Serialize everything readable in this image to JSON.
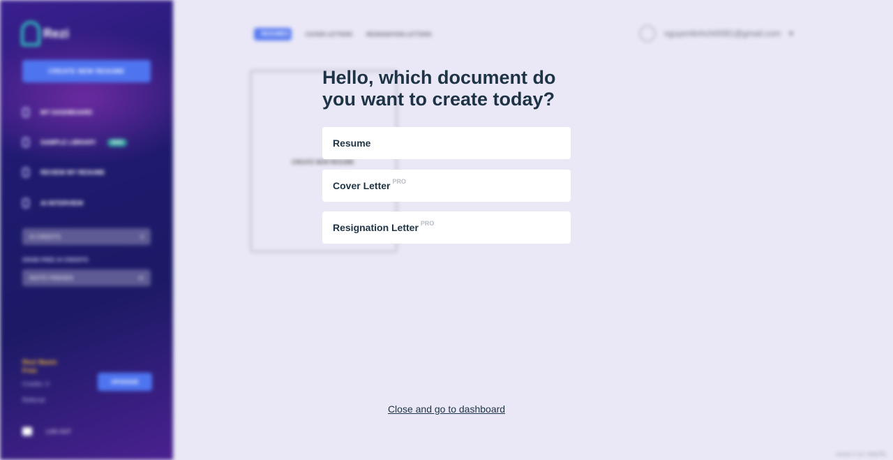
{
  "sidebar": {
    "logo_text": "Rezi",
    "create_button": "CREATE NEW RESUME",
    "nav": [
      {
        "label": "MY DASHBOARD",
        "icon": "dashboard-icon"
      },
      {
        "label": "SAMPLE LIBRARY",
        "icon": "library-icon",
        "badge": "NEW"
      },
      {
        "label": "REVIEW MY RESUME",
        "icon": "review-icon"
      },
      {
        "label": "AI INTERVIEW",
        "icon": "interview-icon"
      }
    ],
    "row1": {
      "label": "AI CREDITS",
      "value": "0"
    },
    "note": "GRAB FREE AI CREDITS",
    "row2": {
      "label": "INVITE FRIENDS",
      "value": "+5"
    },
    "plan_label": "Rezi Basic Free",
    "plan_meta_1": "Credits: 0",
    "plan_meta_2": "Referral",
    "upgrade_button": "UPGRADE",
    "logout": "LOG OUT"
  },
  "main": {
    "tabs": [
      "RESUMES",
      "COVER LETTERS",
      "RESIGNATION LETTERS"
    ],
    "user_email": "nguyenlinhchi0081@gmail.com",
    "card_label": "CREATE NEW RESUME",
    "version": "version 2.16.7 (#8a7f5)"
  },
  "modal": {
    "title": "Hello, which document do you want to create today?",
    "options": [
      {
        "label": "Resume",
        "pro": ""
      },
      {
        "label": "Cover Letter",
        "pro": "PRO"
      },
      {
        "label": "Resignation Letter",
        "pro": "PRO"
      }
    ],
    "close_link": "Close and go to dashboard"
  },
  "colors": {
    "sidebar": "#1e1a6e",
    "accent": "#4e74f0",
    "title": "#1e3346",
    "background": "#eae8f6"
  }
}
